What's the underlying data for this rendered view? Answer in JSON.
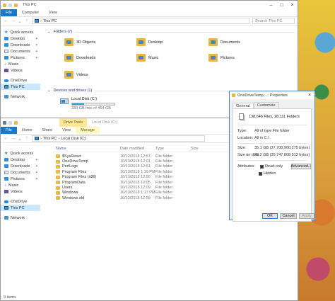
{
  "win1": {
    "title": "This PC",
    "tabs": [
      "File",
      "Computer",
      "View"
    ],
    "address_crumbs": [
      "This PC"
    ],
    "search_placeholder": "Search This PC",
    "nav": [
      {
        "label": "Quick access",
        "icon": "star-icon",
        "pinned": false
      },
      {
        "label": "Desktop",
        "icon": "desktop-icon",
        "pinned": true
      },
      {
        "label": "Downloads",
        "icon": "downloads-icon",
        "pinned": true
      },
      {
        "label": "Documents",
        "icon": "documents-icon",
        "pinned": true
      },
      {
        "label": "Pictures",
        "icon": "pictures-icon",
        "pinned": true
      },
      {
        "label": "Music",
        "icon": "music-icon",
        "pinned": false
      },
      {
        "label": "Videos",
        "icon": "videos-icon",
        "pinned": false
      },
      {
        "label": "OneDrive",
        "icon": "onedrive-icon",
        "pinned": false
      },
      {
        "label": "This PC",
        "icon": "this-pc-icon",
        "pinned": false
      },
      {
        "label": "Network",
        "icon": "network-icon",
        "pinned": false
      }
    ],
    "folders_header": "Folders (7)",
    "folders": [
      "3D Objects",
      "Desktop",
      "Documents",
      "Downloads",
      "Music",
      "Pictures",
      "Videos"
    ],
    "drives_header": "Devices and drives (1)",
    "drive": {
      "name": "Local Disk (C:)",
      "free": "330 GB free of 464 GB",
      "used_fraction": 0.29
    }
  },
  "win2": {
    "title": "Local Disk (C:)",
    "context_label": "Drive Tools",
    "tabs": [
      "File",
      "Home",
      "Share",
      "View",
      "Manage"
    ],
    "address_crumbs": [
      "This PC",
      "Local Disk (C:)"
    ],
    "nav": [
      "Quick access",
      "Desktop",
      "Downloads",
      "Documents",
      "Pictures",
      "Music",
      "Videos",
      "OneDrive",
      "This PC",
      "Network"
    ],
    "columns": [
      "Name",
      "Date modified",
      "Type",
      "Size"
    ],
    "rows": [
      {
        "name": "$SysReset",
        "date": "10/12/2018 12:57",
        "type": "File folder"
      },
      {
        "name": "OneDriveTemp",
        "date": "10/13/2018 12:01",
        "type": "File folder"
      },
      {
        "name": "PerfLogs",
        "date": "10/13/2018 12:51",
        "type": "File folder"
      },
      {
        "name": "Program Files",
        "date": "10/13/2018 1:19 PM",
        "type": "File folder"
      },
      {
        "name": "Program Files (x86)",
        "date": "10/13/2018 12:50",
        "type": "File folder"
      },
      {
        "name": "ProgramData",
        "date": "10/13/2018 10:05",
        "type": "File folder"
      },
      {
        "name": "Users",
        "date": "10/12/2018 12:09",
        "type": "File folder"
      },
      {
        "name": "Windows",
        "date": "10/13/2018 1:17 PM",
        "type": "File folder"
      },
      {
        "name": "Windows.old",
        "date": "10/12/2018 12:59",
        "type": "File folder"
      }
    ],
    "status": "9 items"
  },
  "dialog": {
    "title": "OneDriveTemp, ... Properties",
    "tabs": [
      "General",
      "Customize"
    ],
    "summary": "138,646 Files, 28,111 Folders",
    "props": [
      {
        "k": "Type:",
        "v": "All of type File folder"
      },
      {
        "k": "Location:",
        "v": "All in C:\\"
      },
      {
        "k": "Size:",
        "v": "35.1 GB (37,700,900,275 bytes)"
      },
      {
        "k": "Size on disk:",
        "v": "33.2 GB (35,747,008,512 bytes)"
      }
    ],
    "attributes_label": "Attributes:",
    "readonly_label": "Read-only",
    "hidden_label": "Hidden",
    "advanced_label": "Advanced...",
    "ok_label": "OK",
    "cancel_label": "Cancel",
    "apply_label": "Apply"
  }
}
